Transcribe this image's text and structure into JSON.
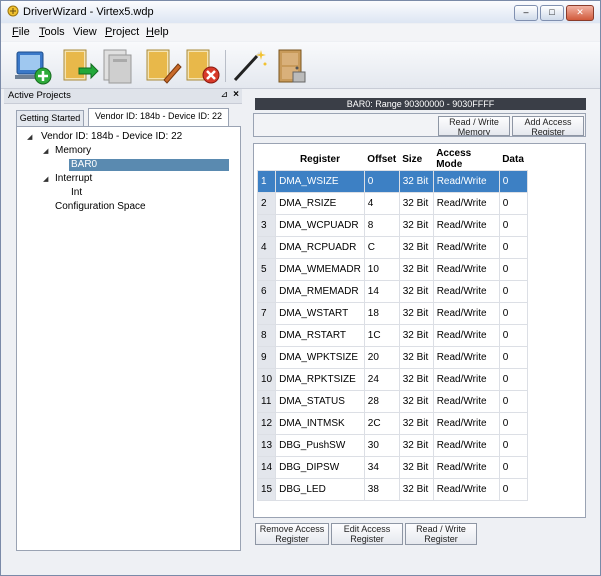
{
  "window": {
    "title": "DriverWizard - Virtex5.wdp",
    "buttons": {
      "minimize": "–",
      "maximize": "□",
      "close": "✕"
    }
  },
  "menu": {
    "items": [
      {
        "accel": "F",
        "rest": "ile"
      },
      {
        "accel": "T",
        "rest": "ools"
      },
      {
        "accel": "",
        "rest": "View"
      },
      {
        "accel": "P",
        "rest": "roject"
      },
      {
        "accel": "H",
        "rest": "elp"
      }
    ]
  },
  "left_panel": {
    "title": "Active Projects",
    "pin_glyph": "⊿",
    "close_glyph": "×",
    "tabs": [
      "Getting Started",
      "Vendor ID: 184b - Device ID: 22"
    ],
    "tree": {
      "root": "Vendor ID: 184b - Device ID: 22",
      "memory": "Memory",
      "bar0": "BAR0",
      "interrupt": "Interrupt",
      "int": "Int",
      "config": "Configuration Space"
    }
  },
  "right_panel": {
    "bar_title": "BAR0: Range 90300000 - 9030FFFF",
    "top_buttons": {
      "read_write_memory": "Read / Write Memory",
      "add_access_register": "Add Access Register"
    },
    "table": {
      "headers": [
        "Register",
        "Offset",
        "Size",
        "Access Mode",
        "Data"
      ],
      "selected_row": 1,
      "rows": [
        {
          "n": "1",
          "register": "DMA_WSIZE",
          "offset": "0",
          "size": "32 Bit",
          "mode": "Read/Write",
          "data": "0"
        },
        {
          "n": "2",
          "register": "DMA_RSIZE",
          "offset": "4",
          "size": "32 Bit",
          "mode": "Read/Write",
          "data": "0"
        },
        {
          "n": "3",
          "register": "DMA_WCPUADR",
          "offset": "8",
          "size": "32 Bit",
          "mode": "Read/Write",
          "data": "0"
        },
        {
          "n": "4",
          "register": "DMA_RCPUADR",
          "offset": "C",
          "size": "32 Bit",
          "mode": "Read/Write",
          "data": "0"
        },
        {
          "n": "5",
          "register": "DMA_WMEMADR",
          "offset": "10",
          "size": "32 Bit",
          "mode": "Read/Write",
          "data": "0"
        },
        {
          "n": "6",
          "register": "DMA_RMEMADR",
          "offset": "14",
          "size": "32 Bit",
          "mode": "Read/Write",
          "data": "0"
        },
        {
          "n": "7",
          "register": "DMA_WSTART",
          "offset": "18",
          "size": "32 Bit",
          "mode": "Read/Write",
          "data": "0"
        },
        {
          "n": "8",
          "register": "DMA_RSTART",
          "offset": "1C",
          "size": "32 Bit",
          "mode": "Read/Write",
          "data": "0"
        },
        {
          "n": "9",
          "register": "DMA_WPKTSIZE",
          "offset": "20",
          "size": "32 Bit",
          "mode": "Read/Write",
          "data": "0"
        },
        {
          "n": "10",
          "register": "DMA_RPKTSIZE",
          "offset": "24",
          "size": "32 Bit",
          "mode": "Read/Write",
          "data": "0"
        },
        {
          "n": "11",
          "register": "DMA_STATUS",
          "offset": "28",
          "size": "32 Bit",
          "mode": "Read/Write",
          "data": "0"
        },
        {
          "n": "12",
          "register": "DMA_INTMSK",
          "offset": "2C",
          "size": "32 Bit",
          "mode": "Read/Write",
          "data": "0"
        },
        {
          "n": "13",
          "register": "DBG_PushSW",
          "offset": "30",
          "size": "32 Bit",
          "mode": "Read/Write",
          "data": "0"
        },
        {
          "n": "14",
          "register": "DBG_DIPSW",
          "offset": "34",
          "size": "32 Bit",
          "mode": "Read/Write",
          "data": "0"
        },
        {
          "n": "15",
          "register": "DBG_LED",
          "offset": "38",
          "size": "32 Bit",
          "mode": "Read/Write",
          "data": "0"
        }
      ]
    },
    "bottom_buttons": {
      "remove_access_register": "Remove Access Register",
      "edit_access_register": "Edit Access Register",
      "read_write_register": "Read / Write Register"
    }
  },
  "colors": {
    "selection": "#3d80c4",
    "tree_selection": "#5a8ab0",
    "bar_header": "#3a3e47"
  }
}
